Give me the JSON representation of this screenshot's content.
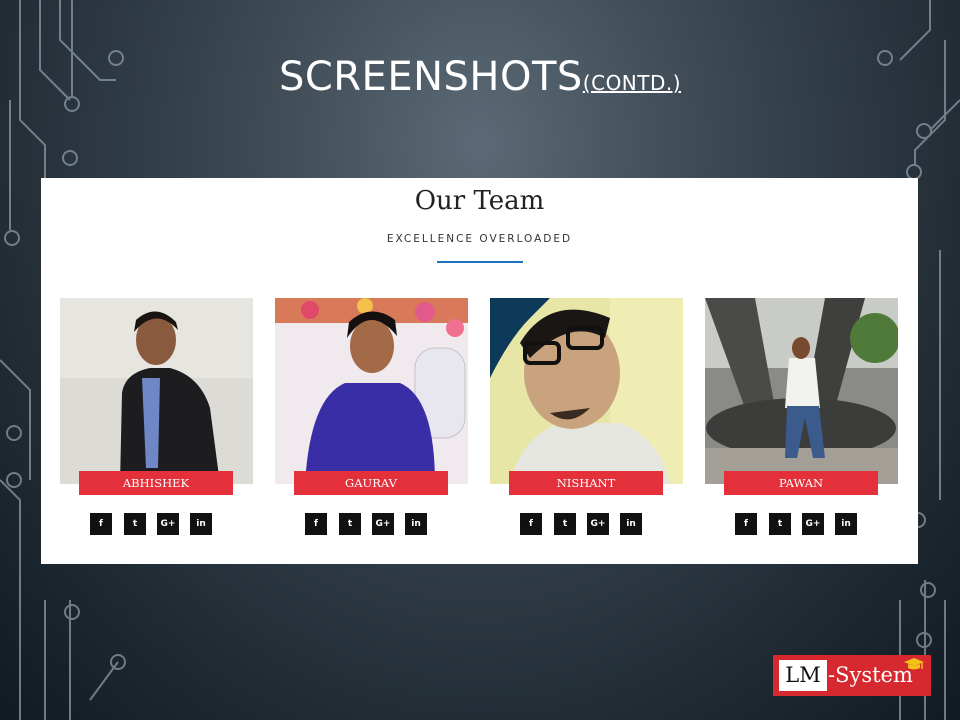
{
  "slide": {
    "title_main": "SCREENSHOTS",
    "title_sub": "(CONTD.)"
  },
  "screenshot": {
    "heading": "Our Team",
    "subheading": "EXCELLENCE OVERLOADED",
    "members": [
      {
        "name": "ABHISHEK",
        "socials": [
          "f",
          "t",
          "G+",
          "in"
        ]
      },
      {
        "name": "GAURAV",
        "socials": [
          "f",
          "t",
          "G+",
          "in"
        ]
      },
      {
        "name": "NISHANT",
        "socials": [
          "f",
          "t",
          "G+",
          "in"
        ]
      },
      {
        "name": "PAWAN",
        "socials": [
          "f",
          "t",
          "G+",
          "in"
        ]
      }
    ],
    "social_icons": [
      "facebook-icon",
      "twitter-icon",
      "google-plus-icon",
      "linkedin-icon"
    ]
  },
  "logo": {
    "box_text": "LM",
    "text": "-System",
    "icon": "graduation-cap-icon"
  },
  "colors": {
    "nameplate": "#e3303b",
    "accent_rule": "#1e73be",
    "logo_bg": "#d6282f"
  }
}
